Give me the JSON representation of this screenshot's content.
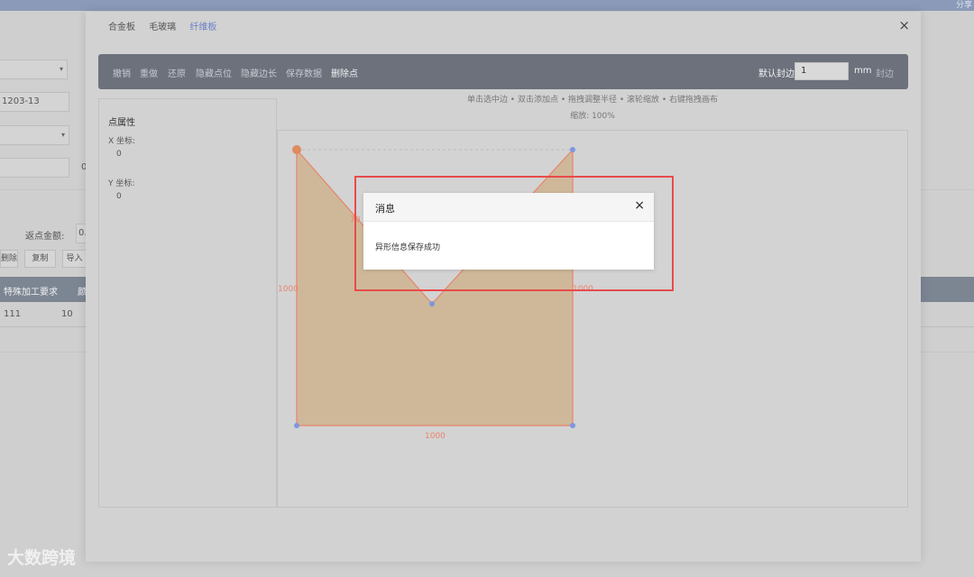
{
  "topbar": {
    "share": "分享"
  },
  "background": {
    "fields": [
      {
        "value": "",
        "has_caret": true
      },
      {
        "value": "1203-13",
        "has_caret": false
      },
      {
        "value": "",
        "has_caret": true
      },
      {
        "value": "",
        "has_caret": false
      }
    ],
    "rebate_label": "返点金额:",
    "rebate_value": "0.",
    "side_text": "0",
    "buttons": [
      "删除",
      "复制",
      "导入"
    ],
    "table": {
      "headers": [
        "特殊加工要求",
        "颜"
      ],
      "row": [
        "111",
        "10"
      ]
    }
  },
  "dialog": {
    "tabs": [
      {
        "label": "合金板",
        "active": false
      },
      {
        "label": "毛玻璃",
        "active": false
      },
      {
        "label": "纤维板",
        "active": true
      }
    ],
    "close": "×",
    "toolbar": {
      "buttons": [
        {
          "label": "撤销",
          "strong": false
        },
        {
          "label": "重做",
          "strong": false
        },
        {
          "label": "还原",
          "strong": false
        },
        {
          "label": "隐藏点位",
          "strong": false
        },
        {
          "label": "隐藏边长",
          "strong": false
        },
        {
          "label": "保存数据",
          "strong": false
        },
        {
          "label": "删除点",
          "strong": true
        }
      ],
      "default_edge_label": "默认封边:",
      "default_edge_value": "1",
      "unit": "mm",
      "apply": "封边"
    },
    "hint": "单击选中边 • 双击添加点 • 拖拽调整半径 • 滚轮缩放 • 右键拖拽画布",
    "zoom": "缩放: 100%",
    "point_props": {
      "title": "点属性",
      "x_label": "X 坐标:",
      "x_value": "0",
      "y_label": "Y 坐标:",
      "y_value": "0"
    },
    "shape": {
      "edge_labels": {
        "left": "1000",
        "right": "1000",
        "bottom": "1000",
        "top_left_partial": "70"
      },
      "fill_color": "#cfb89a",
      "stroke_color": "#e8836a",
      "point_color": "#7f96e0",
      "selected_point_color": "#e08a5f"
    }
  },
  "message": {
    "title": "消息",
    "body": "异形信息保存成功",
    "close": "×"
  },
  "watermark": "大数跨境"
}
